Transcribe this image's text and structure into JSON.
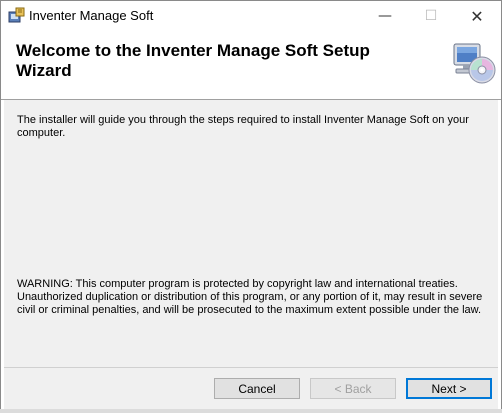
{
  "window": {
    "title": "Inventer Manage Soft",
    "controls": {
      "minimize": "—",
      "maximize": "☐",
      "close": "✕"
    }
  },
  "header": {
    "title": "Welcome to the Inventer Manage Soft Setup Wizard",
    "icon": "computer-with-cd-icon"
  },
  "body": {
    "intro": "The installer will guide you through the steps required to install Inventer Manage Soft on your computer.",
    "warning": "WARNING: This computer program is protected by copyright law and international treaties. Unauthorized duplication or distribution of this program, or any portion of it, may result in severe civil or criminal penalties, and will be prosecuted to the maximum extent possible under the law."
  },
  "footer": {
    "cancel_label": "Cancel",
    "back_label": "< Back",
    "next_label": "Next >"
  },
  "colors": {
    "accent": "#0078d7",
    "panel_bg": "#f0f0f0",
    "disabled_text": "#a0a0a0"
  }
}
